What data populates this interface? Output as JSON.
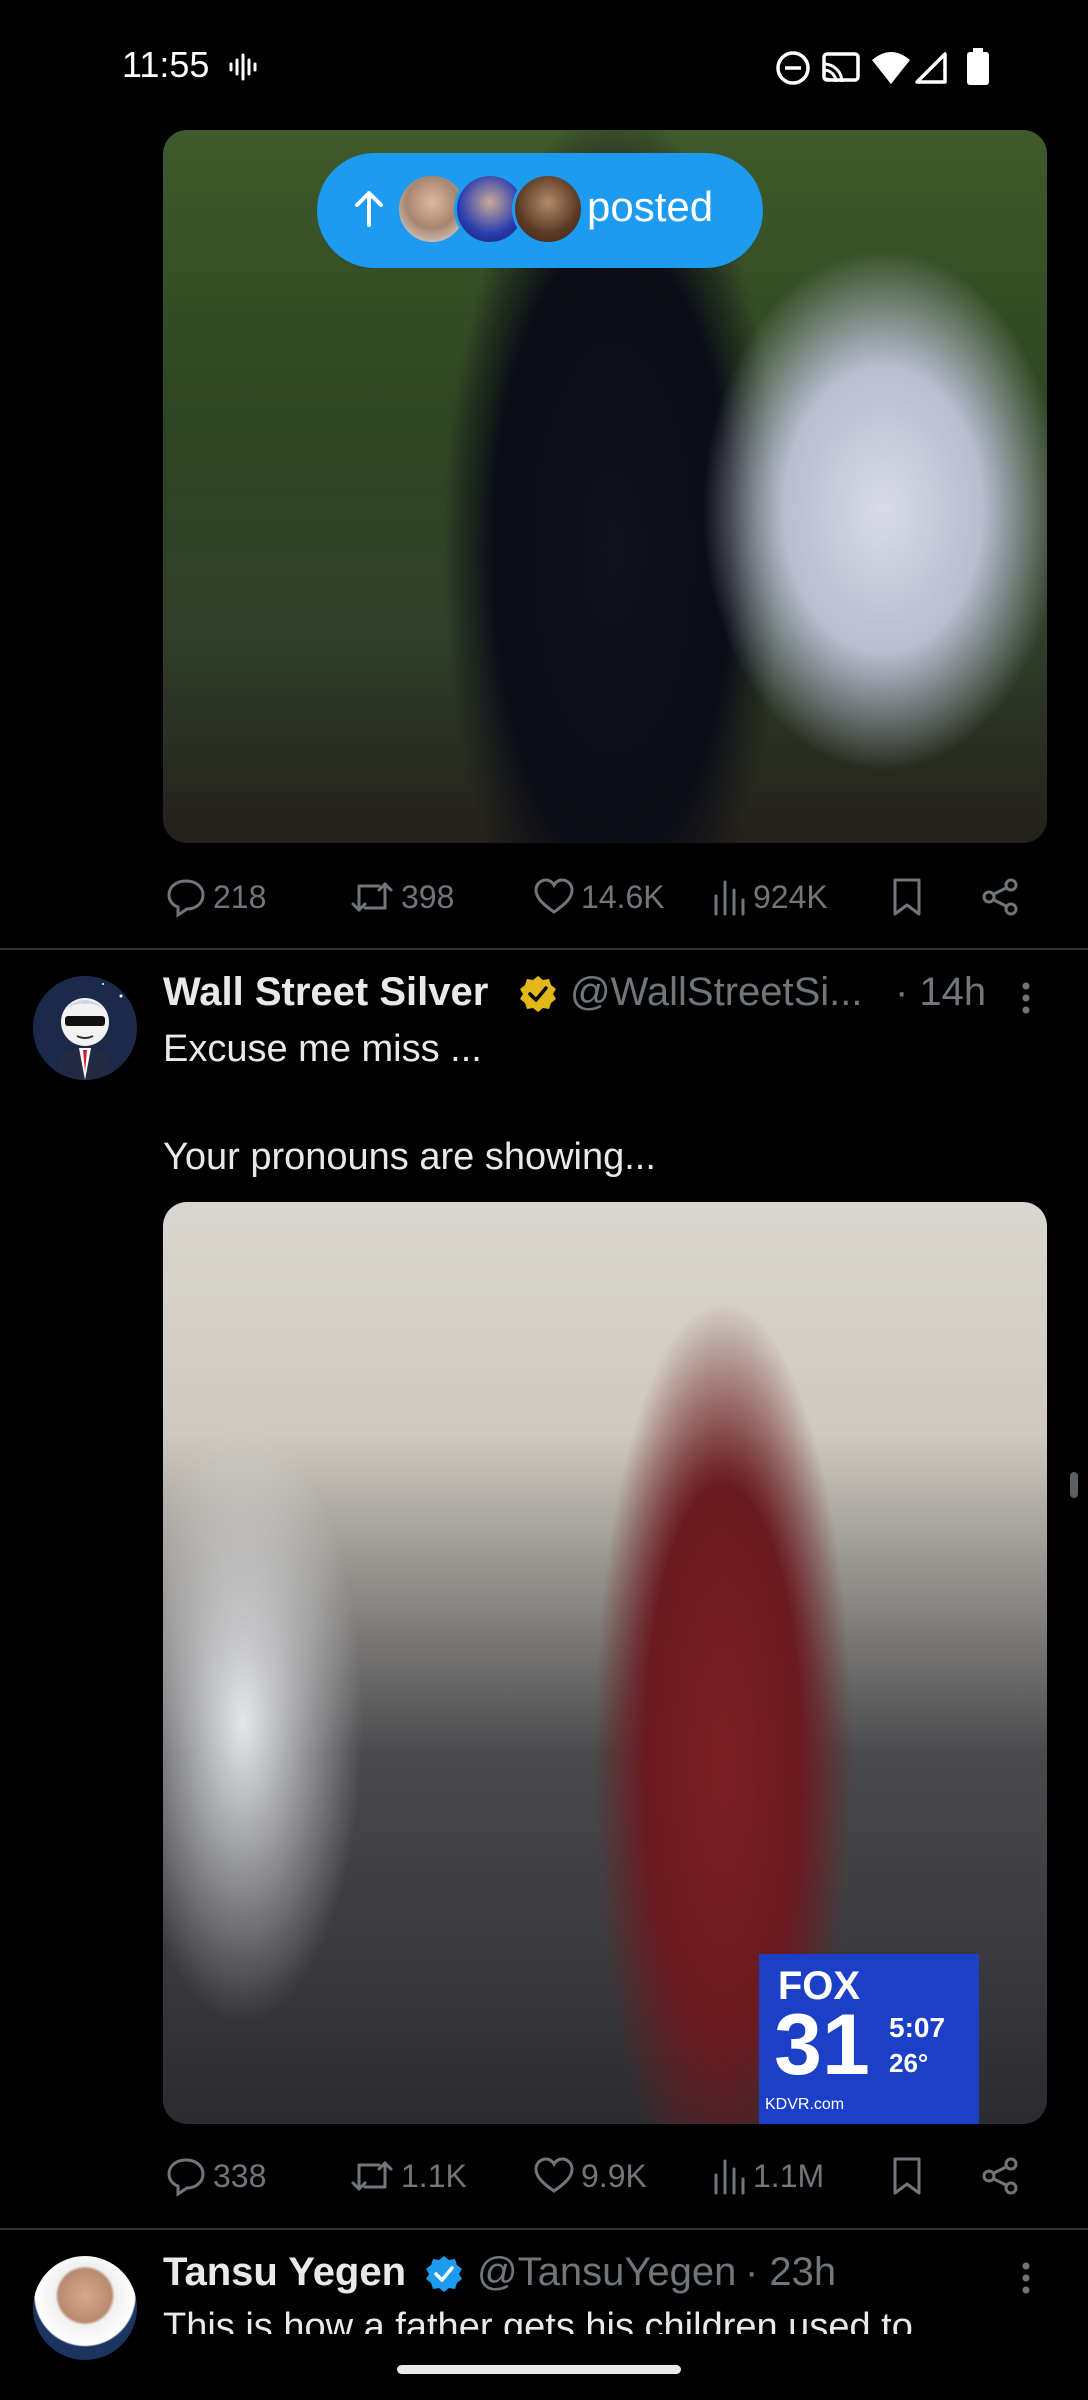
{
  "status_bar": {
    "time": "11:55"
  },
  "feed": {
    "posted_pill": {
      "label": "posted"
    },
    "tweet1": {
      "stats": {
        "replies": "218",
        "reposts": "398",
        "likes": "14.6K",
        "views": "924K"
      }
    },
    "tweet2": {
      "author": "Wall Street Silver",
      "handle": "@WallStreetSi...",
      "time": "· 14h",
      "text_line1": "Excuse me miss ...",
      "text_line2": "Your pronouns are showing...",
      "image_overlay": {
        "station": "FOX",
        "channel": "31",
        "clock": "5:07",
        "temp": "26°",
        "site": "KDVR.com"
      },
      "stats": {
        "replies": "338",
        "reposts": "1.1K",
        "likes": "9.9K",
        "views": "1.1M"
      }
    },
    "tweet3": {
      "author": "Tansu Yegen",
      "handle": "@TansuYegen",
      "time": "· 23h",
      "text_line1": "This is how a father gets his children used to"
    }
  },
  "colors": {
    "accent": "#1d9bf0",
    "verified_gold": "#e2b719",
    "muted": "#71767b"
  }
}
